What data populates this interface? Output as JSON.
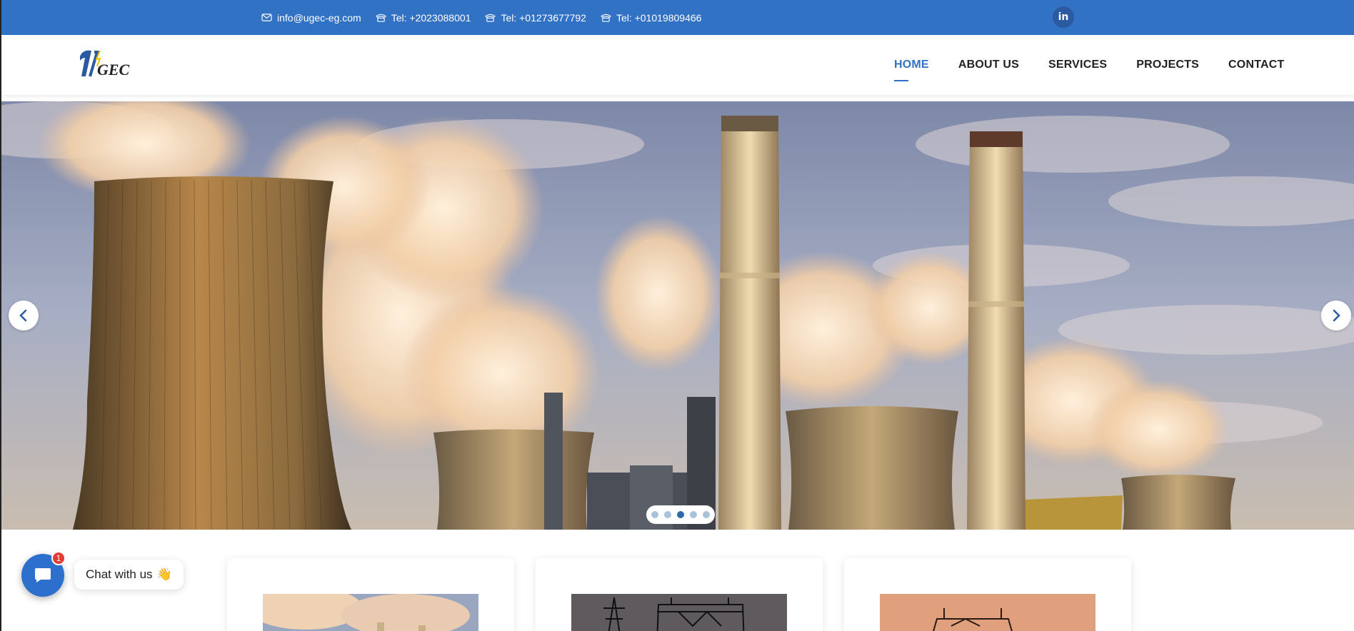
{
  "topbar": {
    "email": "info@ugec-eg.com",
    "phones": [
      "Tel: +2023088001",
      "Tel: +01273677792",
      "Tel: +01019809466"
    ],
    "social": {
      "linkedin_label": "in"
    },
    "bg_color": "#3272c4"
  },
  "header": {
    "logo_text": "GEC",
    "nav": [
      {
        "label": "HOME",
        "active": true
      },
      {
        "label": "ABOUT US",
        "active": false
      },
      {
        "label": "SERVICES",
        "active": false
      },
      {
        "label": "PROJECTS",
        "active": false
      },
      {
        "label": "CONTACT",
        "active": false
      }
    ]
  },
  "hero": {
    "slide_count": 5,
    "active_slide": 3,
    "prev_icon": "chevron-left-icon",
    "next_icon": "chevron-right-icon"
  },
  "chat": {
    "label": "Chat with us",
    "emoji": "👋",
    "badge_count": "1",
    "icon": "chat-bubble-icon"
  },
  "colors": {
    "accent": "#3272c4",
    "badge": "#e53935"
  }
}
